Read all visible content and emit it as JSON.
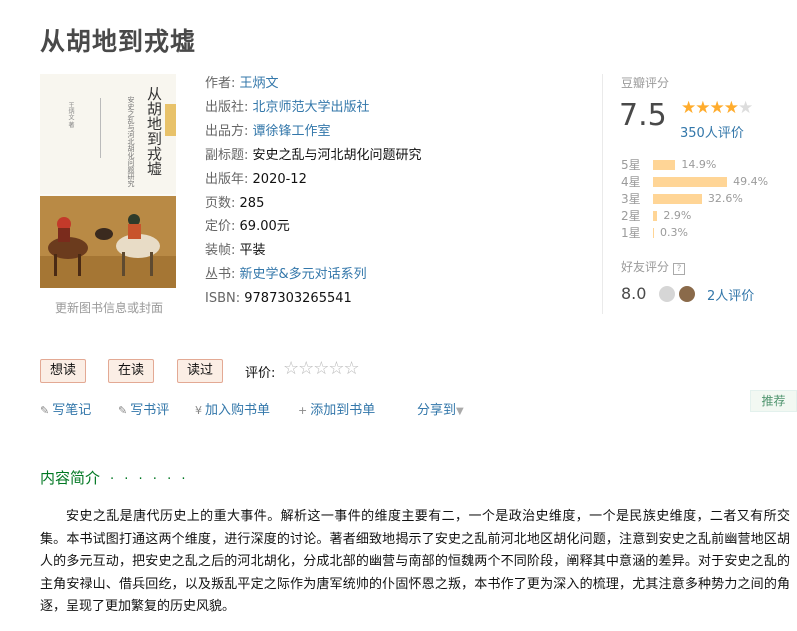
{
  "book": {
    "title": "从胡地到戎墟",
    "update_link": "更新图书信息或封面",
    "cover": {
      "title": "从胡地到戎墟",
      "subtitle": "安史之乱与河北胡化问题研究",
      "author_short": "王炳文 著"
    },
    "info": {
      "author_label": "作者:",
      "author": "王炳文",
      "publisher_label": "出版社:",
      "publisher": "北京师范大学出版社",
      "producer_label": "出品方:",
      "producer": "谭徐锋工作室",
      "subtitle_label": "副标题:",
      "subtitle": "安史之乱与河北胡化问题研究",
      "year_label": "出版年:",
      "year": "2020-12",
      "pages_label": "页数:",
      "pages": "285",
      "price_label": "定价:",
      "price": "69.00元",
      "binding_label": "装帧:",
      "binding": "平装",
      "series_label": "丛书:",
      "series": "新史学&多元对话系列",
      "isbn_label": "ISBN:",
      "isbn": "9787303265541"
    }
  },
  "rating": {
    "label": "豆瓣评分",
    "score": "7.5",
    "stars_filled": "★★★★",
    "stars_empty": "★",
    "count": "350人评价",
    "distribution": [
      {
        "label": "5星",
        "percent": "14.9%",
        "value": 14.9
      },
      {
        "label": "4星",
        "percent": "49.4%",
        "value": 49.4
      },
      {
        "label": "3星",
        "percent": "32.6%",
        "value": 32.6
      },
      {
        "label": "2星",
        "percent": "2.9%",
        "value": 2.9
      },
      {
        "label": "1星",
        "percent": "0.3%",
        "value": 0.3
      }
    ],
    "friend_label": "好友评分",
    "friend_help": "?",
    "friend_score": "8.0",
    "friend_count": "2人评价"
  },
  "actions": {
    "want": "想读",
    "reading": "在读",
    "read": "读过",
    "my_rating_label": "评价:",
    "my_stars": "☆☆☆☆☆",
    "write_note": "写笔记",
    "write_review": "写书评",
    "add_cart": "加入购书单",
    "add_list": "添加到书单",
    "share": "分享到",
    "recommend": "推荐"
  },
  "intro": {
    "heading": "内容简介",
    "dots": "· · · · · ·",
    "text": "安史之乱是唐代历史上的重大事件。解析这一事件的维度主要有二，一个是政治史维度，一个是民族史维度，二者又有所交集。本书试图打通这两个维度，进行深度的讨论。著者细致地揭示了安史之乱前河北地区胡化问题，注意到安史之乱前幽营地区胡人的多元互动，把安史之乱之后的河北胡化，分成北部的幽营与南部的恒魏两个不同阶段，阐释其中意涵的差异。对于安史之乱的主角安禄山、借兵回纥，以及叛乱平定之际作为唐军统帅的仆固怀恩之叛，本书作了更为深入的梳理，尤其注意多种势力之间的角逐，呈现了更加繁复的历史风貌。"
  },
  "colors": {
    "link": "#3377aa",
    "star": "#ffac2d",
    "bar": "#ffd596",
    "green": "#007722"
  }
}
